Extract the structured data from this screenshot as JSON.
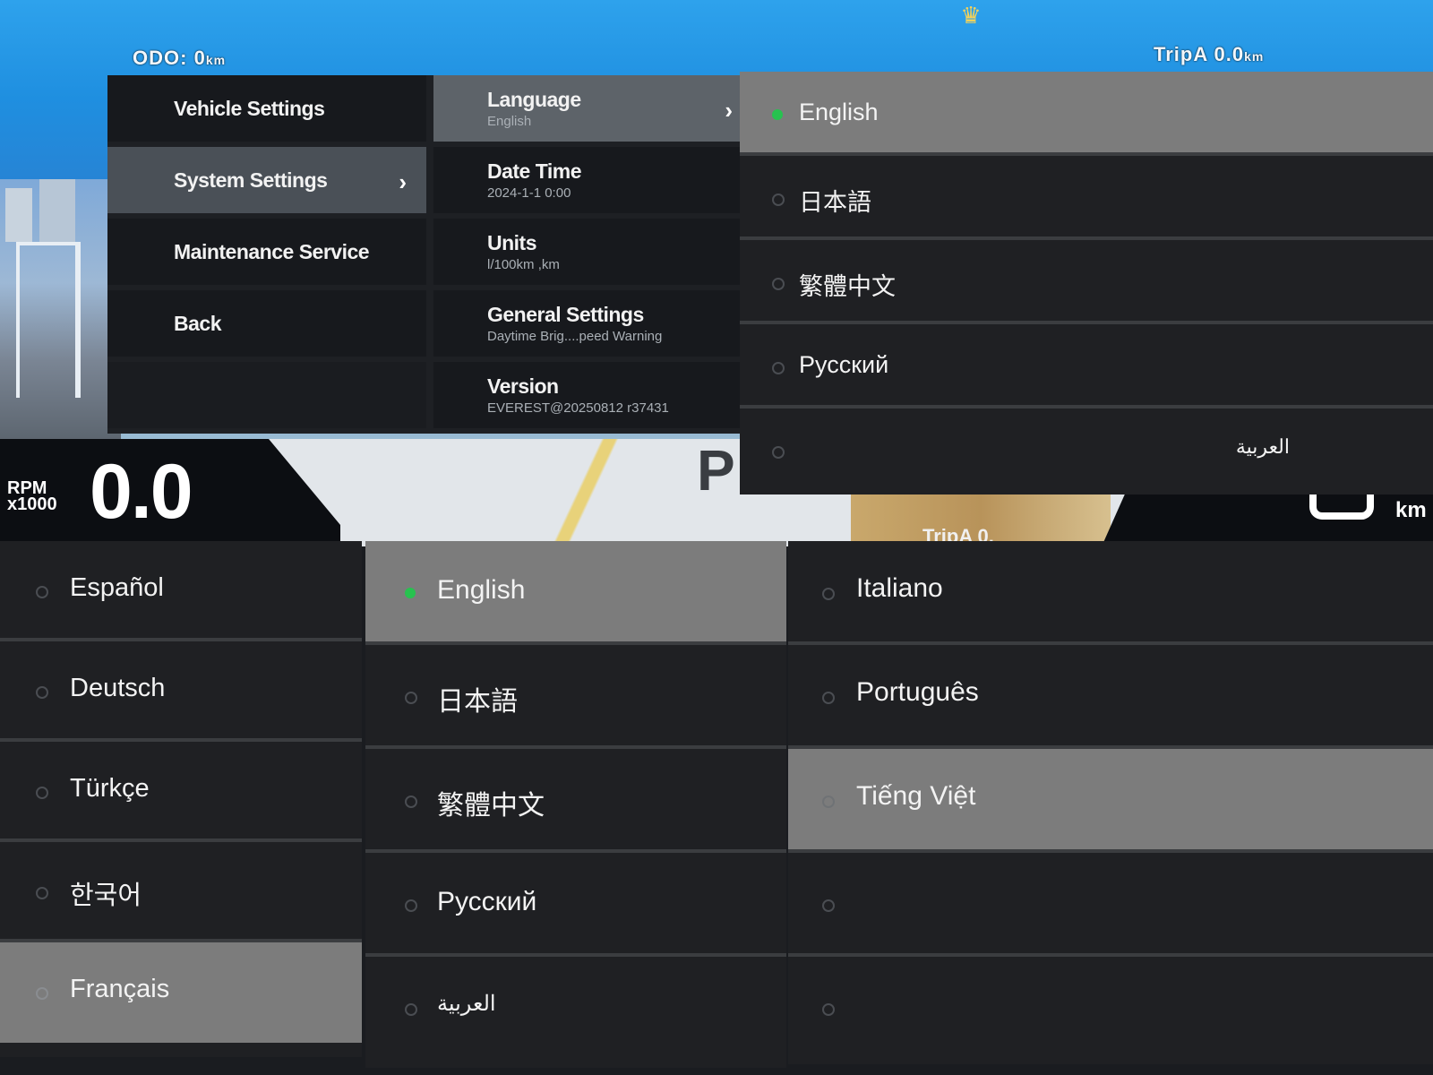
{
  "cluster": {
    "odometer_label": "ODO:",
    "odometer_value": "0",
    "odometer_unit": "km",
    "trip_label": "TripA",
    "trip_value": "0.0",
    "trip_unit": "km",
    "rpm_label_line1": "RPM",
    "rpm_label_line2": "x1000",
    "rpm_value": "0.0",
    "gear": "P",
    "speed_unit": "km",
    "trip_lower": "TripA 0."
  },
  "menu": {
    "left": [
      {
        "label": "Vehicle Settings"
      },
      {
        "label": "System Settings",
        "chevron": "›"
      },
      {
        "label": "Maintenance Service"
      },
      {
        "label": "Back"
      }
    ],
    "right": [
      {
        "title": "Language",
        "sub": "English",
        "chevron": "›"
      },
      {
        "title": "Date Time",
        "sub": "2024-1-1 0:00"
      },
      {
        "title": "Units",
        "sub": "l/100km ,km"
      },
      {
        "title": "General Settings",
        "sub": "Daytime Brig....peed Warning"
      },
      {
        "title": "Version",
        "sub": "EVEREST@20250812 r37431"
      }
    ]
  },
  "panel_a": [
    {
      "label": "English",
      "selected": true
    },
    {
      "label": "日本語"
    },
    {
      "label": "繁體中文"
    },
    {
      "label": "Русский"
    },
    {
      "label": "العربية",
      "rtl": true
    }
  ],
  "panel_b": [
    {
      "label": "Español"
    },
    {
      "label": "Deutsch"
    },
    {
      "label": "Türkçe"
    },
    {
      "label": "한국어"
    },
    {
      "label": "Français",
      "highlight": true
    }
  ],
  "panel_c": [
    {
      "label": "English",
      "selected": true
    },
    {
      "label": "日本語"
    },
    {
      "label": "繁體中文"
    },
    {
      "label": "Русский"
    },
    {
      "label": "العربية",
      "rtl": true
    }
  ],
  "panel_d": [
    {
      "label": "Italiano"
    },
    {
      "label": "Português"
    },
    {
      "label": "Tiếng Việt",
      "highlight": true
    },
    {
      "label": ""
    },
    {
      "label": ""
    }
  ],
  "colors": {
    "selected_dot": "#27c24f",
    "row_bg": "#1f2023",
    "row_selected": "#7c7c7c",
    "sky": "#2ea2ec"
  }
}
